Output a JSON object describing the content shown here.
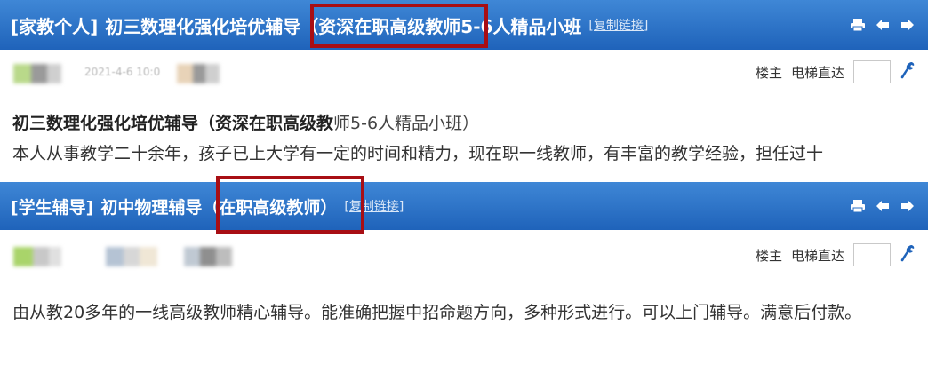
{
  "posts": [
    {
      "category": "[家教个人]",
      "title_before": "初三数理化强化培优辅导",
      "title_highlight": "（资深在职高级教师",
      "title_after": "5-6人精品小班",
      "copy_link": "[复制链接]",
      "date": "2021-4-6 10:0",
      "floor_owner": "楼主",
      "elevator": "电梯直达",
      "heading_bold": "初三数理化强化培优辅导（资深在职高级教",
      "heading_rest": "师5-6人精品小班）",
      "body": "本人从事教学二十余年，孩子已上大学有一定的时间和精力，现在职一线教师，有丰富的教学经验，担任过十"
    },
    {
      "category": "[学生辅导]",
      "title_before": "初中物理辅导",
      "title_highlight": "（在职高级教师）",
      "title_after": "",
      "copy_link": "[复制链接]",
      "floor_owner": "楼主",
      "elevator": "电梯直达",
      "body": "由从教20多年的一线高级教师精心辅导。能准确把握中招命题方向，多种形式进行。可以上门辅导。满意后付款。"
    }
  ],
  "icons": [
    "print-icon",
    "arrow-left-icon",
    "arrow-right-icon",
    "wrench-icon"
  ],
  "colors": {
    "title_bar": "#2a6fc5",
    "highlight": "#a80e14",
    "text": "#333333"
  }
}
